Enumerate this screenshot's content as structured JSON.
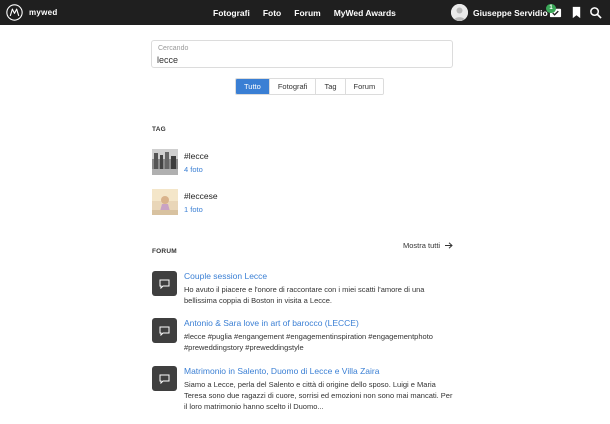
{
  "header": {
    "logo_text": "mywed",
    "nav": [
      "Fotografi",
      "Foto",
      "Forum",
      "MyWed Awards"
    ],
    "user_name": "Giuseppe Servidio",
    "notification_count": "1"
  },
  "search": {
    "label": "Cercando",
    "value": "lecce"
  },
  "filters": {
    "tabs": [
      "Tutto",
      "Fotografi",
      "Tag",
      "Forum"
    ],
    "active": "Tutto"
  },
  "tags": {
    "title": "TAG",
    "items": [
      {
        "name": "#lecce",
        "count": "4 foto"
      },
      {
        "name": "#leccese",
        "count": "1 foto"
      }
    ]
  },
  "forum": {
    "title": "FORUM",
    "show_all": "Mostra tutti",
    "items": [
      {
        "title": "Couple session Lecce",
        "excerpt": "Ho avuto il piacere e l'onore di raccontare con i miei scatti l'amore di una bellissima coppia di Boston in visita a Lecce."
      },
      {
        "title": "Antonio & Sara love in art of barocco (LECCE)",
        "excerpt": "#lecce #puglia #engangement #engagementinspiration #engagementphoto #preweddingstory #preweddingstyle"
      },
      {
        "title": "Matrimonio in Salento, Duomo di Lecce e Villa Zaira",
        "excerpt": "Siamo a Lecce, perla del Salento e città di origine dello sposo. Luigi e Maria Teresa sono due ragazzi di cuore, sorrisi ed emozioni non sono mai mancati. Per il loro matrimonio hanno scelto il Duomo..."
      }
    ]
  },
  "colors": {
    "header_bg": "#1f1f1f",
    "accent": "#3a7fd4",
    "badge": "#3aa757",
    "forum_icon_bg": "#3f3f3f"
  },
  "icons": {
    "logo": "mywed-logo-icon",
    "messages": "check-mail-icon",
    "bookmark": "bookmark-icon",
    "search": "search-icon",
    "forum": "chat-bubble-icon",
    "show_all": "arrow-right-icon"
  }
}
